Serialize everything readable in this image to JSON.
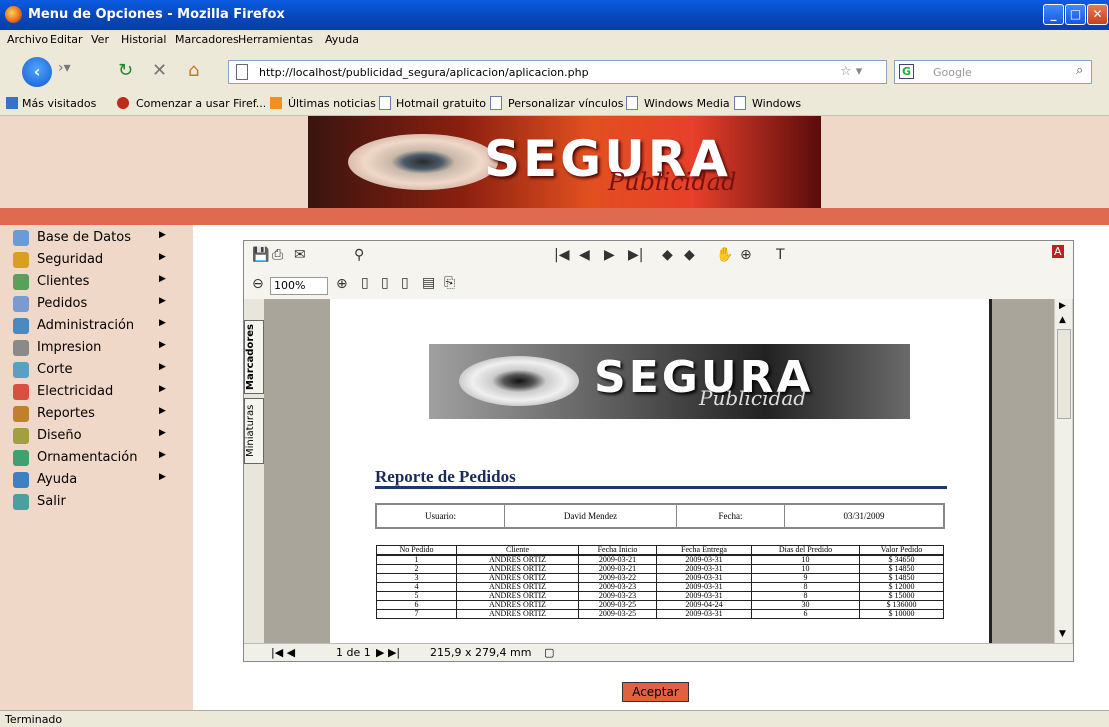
{
  "window": {
    "title": "Menu de Opciones - Mozilla Firefox"
  },
  "menu": [
    "Archivo",
    "Editar",
    "Ver",
    "Historial",
    "Marcadores",
    "Herramientas",
    "Ayuda"
  ],
  "address": {
    "url": "http://localhost/publicidad_segura/aplicacion/aplicacion.php"
  },
  "search": {
    "placeholder": "Google"
  },
  "bookmarks": [
    "Más visitados",
    "Comenzar a usar Firef...",
    "Últimas noticias",
    "Hotmail gratuito",
    "Personalizar vínculos",
    "Windows Media",
    "Windows"
  ],
  "banner": {
    "brand": "SEGURA",
    "sub": "Publicidad"
  },
  "sidebar": {
    "items": [
      {
        "label": "Base de Datos",
        "color": "#6a9ad8"
      },
      {
        "label": "Seguridad",
        "color": "#d8a020"
      },
      {
        "label": "Clientes",
        "color": "#5aa05a"
      },
      {
        "label": "Pedidos",
        "color": "#7a9ad0"
      },
      {
        "label": "Administración",
        "color": "#4a8ac0"
      },
      {
        "label": "Impresion",
        "color": "#8a8a8a"
      },
      {
        "label": "Corte",
        "color": "#5aa0c0"
      },
      {
        "label": "Electricidad",
        "color": "#d85040"
      },
      {
        "label": "Reportes",
        "color": "#c08030"
      },
      {
        "label": "Diseño",
        "color": "#a0a040"
      },
      {
        "label": "Ornamentación",
        "color": "#40a070"
      },
      {
        "label": "Ayuda",
        "color": "#4080c0"
      },
      {
        "label": "Salir",
        "color": "#4aa0a0"
      }
    ]
  },
  "pdf": {
    "zoom": "100%",
    "tabs": {
      "bookmarks": "Marcadores",
      "thumbs": "Miniaturas"
    },
    "page_nav": "1 de 1",
    "page_size": "215,9 x 279,4 mm",
    "report": {
      "title": "Reporte de Pedidos",
      "user_label": "Usuario:",
      "user": "David Mendez",
      "date_label": "Fecha:",
      "date": "03/31/2009",
      "headers": [
        "No Pedido",
        "Cliente",
        "Fecha Inicio",
        "Fecha Entrega",
        "Dias del Predido",
        "Valor Pedido"
      ],
      "rows": [
        [
          "1",
          "ANDRES ORTIZ",
          "2009-03-21",
          "2009-03-31",
          "10",
          "$ 34650"
        ],
        [
          "2",
          "ANDRES ORTIZ",
          "2009-03-21",
          "2009-03-31",
          "10",
          "$ 14850"
        ],
        [
          "3",
          "ANDRES ORTIZ",
          "2009-03-22",
          "2009-03-31",
          "9",
          "$ 14850"
        ],
        [
          "4",
          "ANDRES ORTIZ",
          "2009-03-23",
          "2009-03-31",
          "8",
          "$ 12000"
        ],
        [
          "5",
          "ANDRES ORTIZ",
          "2009-03-23",
          "2009-03-31",
          "8",
          "$ 15000"
        ],
        [
          "6",
          "ANDRES ORTIZ",
          "2009-03-25",
          "2009-04-24",
          "30",
          "$ 136000"
        ],
        [
          "7",
          "ANDRES ORTIZ",
          "2009-03-25",
          "2009-03-31",
          "6",
          "$ 10000"
        ]
      ]
    }
  },
  "button": {
    "accept": "Aceptar"
  },
  "status": {
    "text": "Terminado"
  }
}
